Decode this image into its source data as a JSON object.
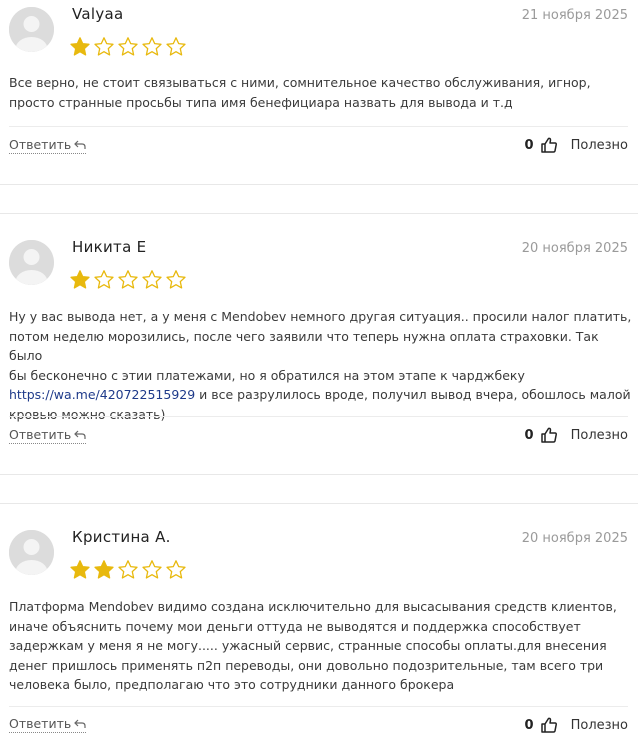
{
  "colors": {
    "star_filled": "#e8b90e",
    "star_empty_outline": "#e8b90e",
    "link": "#1e3a8a"
  },
  "reviews": [
    {
      "author": "Valyaa",
      "date": "21 ноября 2025",
      "rating": 1,
      "max_rating": 5,
      "text_lines": [
        "Все верно, не стоит связываться с ними, сомнительное качество обслуживания, игнор,",
        "просто странные просьбы типа имя бенефициара назвать для вывода и т.д"
      ],
      "reply_label": "Ответить",
      "useful_count": "0",
      "useful_label": "Полезно"
    },
    {
      "author": "Никита Е",
      "date": "20 ноября 2025",
      "rating": 1,
      "max_rating": 5,
      "text_lines": [
        "Ну у вас вывода нет, а у меня с Mendobev немного другая ситуация.. просили налог платить,",
        "потом неделю морозились, после чего заявили что теперь нужна оплата страховки. Так было",
        "бы бесконечно с этии платежами, но я обратился на этом этапе к чарджбеку"
      ],
      "link_text": "https://wa.me/420722515929",
      "link_tail": " и все разрулилось вроде, получил вывод вчера, обошлось малой",
      "last_line": "кровью можно сказать)",
      "reply_label": "Ответить",
      "useful_count": "0",
      "useful_label": "Полезно"
    },
    {
      "author": "Кристина А.",
      "date": "20 ноября 2025",
      "rating": 2,
      "max_rating": 5,
      "text_lines": [
        "Платформа Mendobev видимо создана исключительно для высасывания средств клиентов,",
        "иначе объяснить почему мои деньги оттуда не выводятся и поддержка способствует",
        "задержкам у меня я не могу..... ужасный сервис, странные способы оплаты.для внесения",
        "денег пришлось применять п2п переводы, они довольно подозрительные, там всего три",
        "человека было, предполагаю что это сотрудники данного брокера"
      ],
      "reply_label": "Ответить",
      "useful_count": "0",
      "useful_label": "Полезно"
    }
  ]
}
